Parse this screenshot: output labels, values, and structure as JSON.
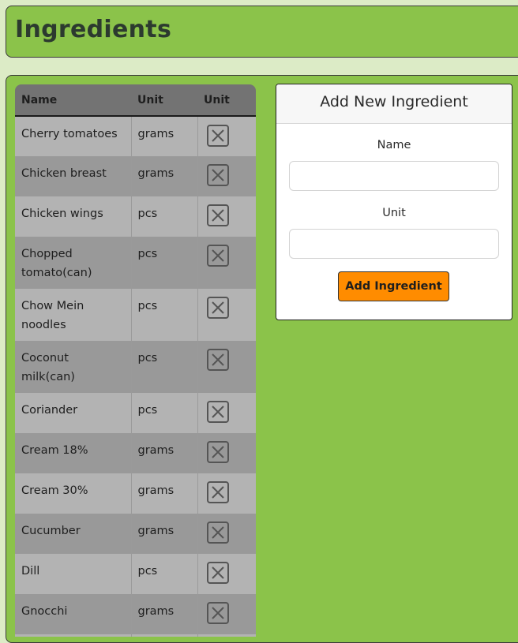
{
  "page": {
    "title": "Ingredients"
  },
  "table": {
    "headers": [
      "Name",
      "Unit",
      "Unit"
    ],
    "rows": [
      {
        "name": "Cherry tomatoes",
        "unit": "grams"
      },
      {
        "name": "Chicken breast",
        "unit": "grams"
      },
      {
        "name": "Chicken wings",
        "unit": "pcs"
      },
      {
        "name": "Chopped tomato(can)",
        "unit": "pcs"
      },
      {
        "name": "Chow Mein noodles",
        "unit": "pcs"
      },
      {
        "name": "Coconut milk(can)",
        "unit": "pcs"
      },
      {
        "name": "Coriander",
        "unit": "pcs"
      },
      {
        "name": "Cream 18%",
        "unit": "grams"
      },
      {
        "name": "Cream 30%",
        "unit": "grams"
      },
      {
        "name": "Cucumber",
        "unit": "grams"
      },
      {
        "name": "Dill",
        "unit": "pcs"
      },
      {
        "name": "Gnocchi",
        "unit": "grams"
      },
      {
        "name": "",
        "unit": ""
      }
    ]
  },
  "form": {
    "title": "Add New Ingredient",
    "name_label": "Name",
    "name_value": "",
    "unit_label": "Unit",
    "unit_value": "",
    "submit_label": "Add Ingredient"
  },
  "icons": {
    "delete": "close-square-icon"
  },
  "colors": {
    "panel_green": "#8bc34a",
    "button_orange": "#ff8c00",
    "table_header": "#737373"
  }
}
